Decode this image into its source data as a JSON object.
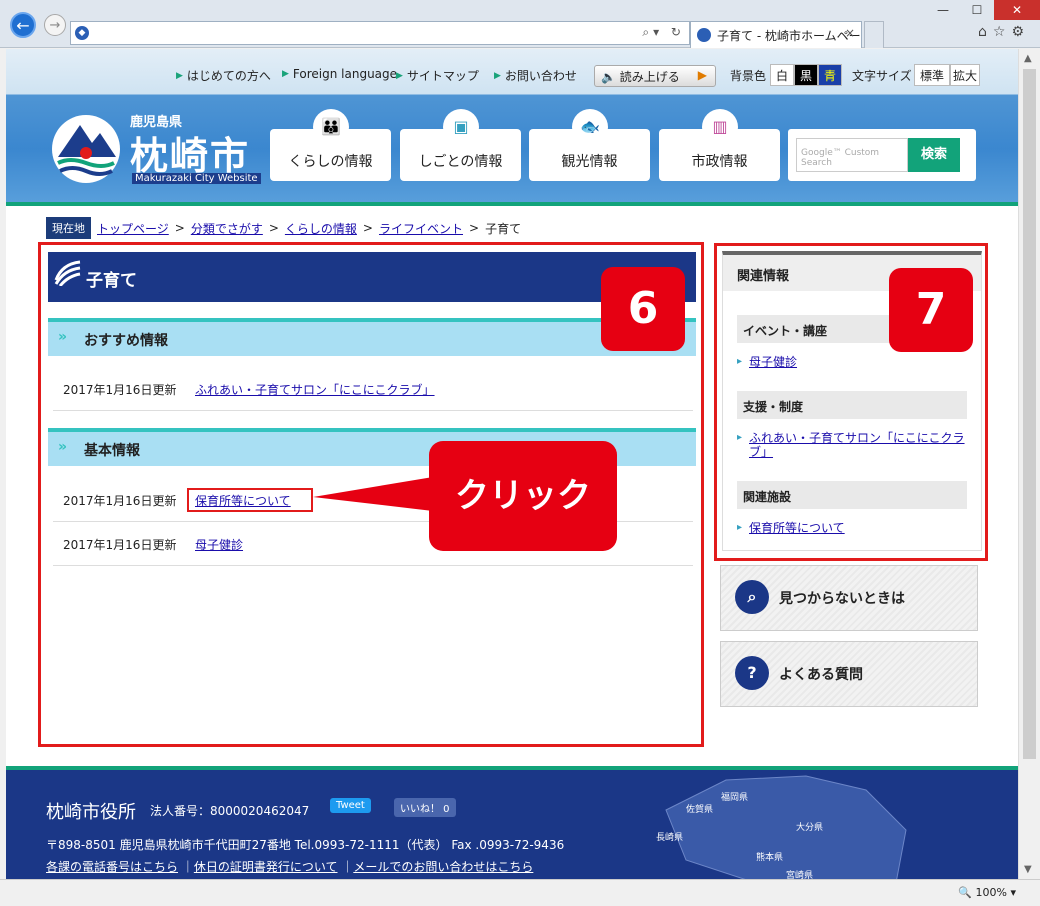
{
  "browser": {
    "tab_title": "子育て - 枕崎市ホームページ",
    "tab_close": "×",
    "zoom": "100%"
  },
  "util_links": [
    "はじめての方へ",
    "Foreign language",
    "サイトマップ",
    "お問い合わせ"
  ],
  "read_aloud": "読み上げる",
  "bg_color_label": "背景色",
  "bg_options": [
    "白",
    "黒",
    "青"
  ],
  "font_size_label": "文字サイズ",
  "font_options": [
    "標準",
    "拡大"
  ],
  "logo": {
    "pref": "鹿児島県",
    "city": "枕崎市",
    "en": "Makurazaki City Website"
  },
  "menu": [
    "くらしの情報",
    "しごとの情報",
    "観光情報",
    "市政情報"
  ],
  "search": {
    "placeholder": "Google™ Custom Search",
    "button": "検索"
  },
  "breadcrumb": {
    "here": "現在地",
    "items": [
      "トップページ",
      "分類でさがす",
      "くらしの情報",
      "ライフイベント"
    ],
    "current": "子育て"
  },
  "page_title": "子育て",
  "sections": [
    {
      "title": "おすすめ情報",
      "rows": [
        {
          "date": "2017年1月16日更新",
          "link": "ふれあい・子育てサロン「にこにこクラブ」"
        }
      ]
    },
    {
      "title": "基本情報",
      "rows": [
        {
          "date": "2017年1月16日更新",
          "link": "保育所等について"
        },
        {
          "date": "2017年1月16日更新",
          "link": "母子健診"
        }
      ]
    }
  ],
  "annotations": {
    "callout": "クリック",
    "badge_main": "6",
    "badge_side": "7"
  },
  "related": {
    "title": "関連情報",
    "groups": [
      {
        "title": "イベント・講座",
        "links": [
          "母子健診"
        ]
      },
      {
        "title": "支援・制度",
        "links": [
          "ふれあい・子育てサロン「にこにこクラブ」"
        ]
      },
      {
        "title": "関連施設",
        "links": [
          "保育所等について"
        ]
      }
    ]
  },
  "help_buttons": [
    "見つからないときは",
    "よくある質問"
  ],
  "footer": {
    "name": "枕崎市役所",
    "corp_no": "法人番号：8000020462047",
    "tweet": "Tweet",
    "like": "いいね！ 0",
    "address": "〒898-8501 鹿児島県枕崎市千代田町27番地 Tel.0993-72-1111（代表） Fax .0993-72-9436",
    "links": [
      "各課の電話番号はこちら",
      "休日の証明書発行について",
      "メールでのお問い合わせはこちら"
    ],
    "map_labels": [
      "福岡県",
      "佐賀県",
      "大分県",
      "長崎県",
      "熊本県",
      "宮崎県"
    ]
  },
  "colors": {
    "navy": "#1b3787",
    "accent": "#12a37a",
    "annotation": "#e60012",
    "teal": "#35c3c0"
  }
}
